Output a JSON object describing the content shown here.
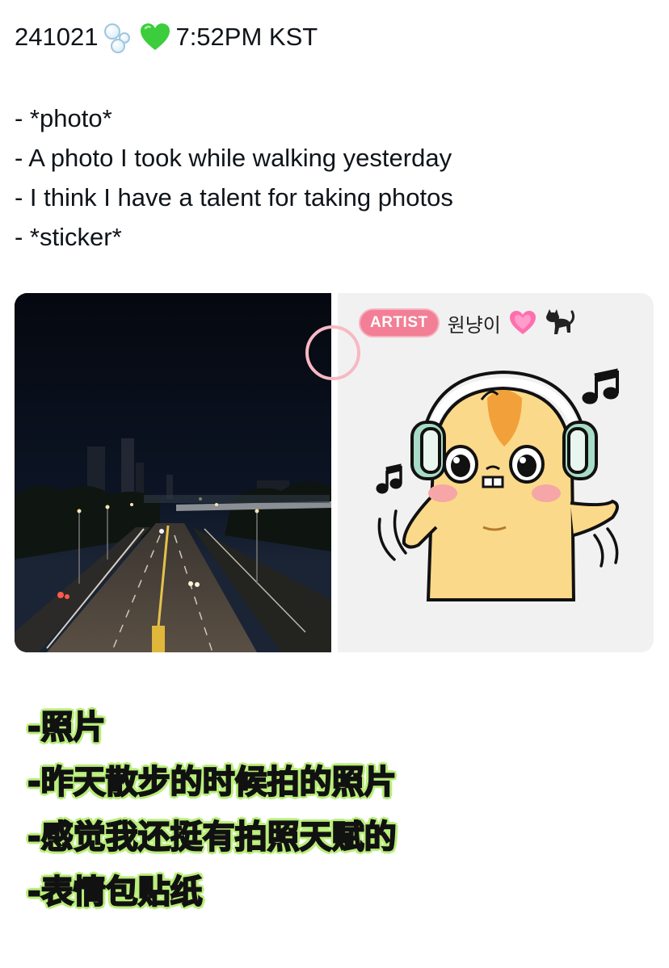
{
  "header": {
    "date": "241021",
    "time": "7:52PM KST",
    "icons": [
      "bubbles-icon",
      "green-heart-icon"
    ]
  },
  "caption": {
    "lines": [
      "- *photo*",
      "- A photo I took while walking yesterday",
      "- I think I have a talent for taking photos",
      "- *sticker*"
    ]
  },
  "media": {
    "photo_icon": "night-highway-photo",
    "sticker": {
      "badge": "ARTIST",
      "name": "원냥이",
      "icons": [
        "pink-heart-icon",
        "black-cat-icon",
        "hamster-headphones-sticker",
        "music-note-icon"
      ]
    }
  },
  "translations": {
    "lines": [
      "-照片",
      "-昨天散步的时候拍的照片",
      "-感觉我还挺有拍照天赋的",
      "-表情包贴纸"
    ]
  },
  "colors": {
    "badge": "#f27f95",
    "highlight": "#b9ee7a",
    "green_heart": "#3ccd3c",
    "pink_heart": "#ff6fae"
  }
}
